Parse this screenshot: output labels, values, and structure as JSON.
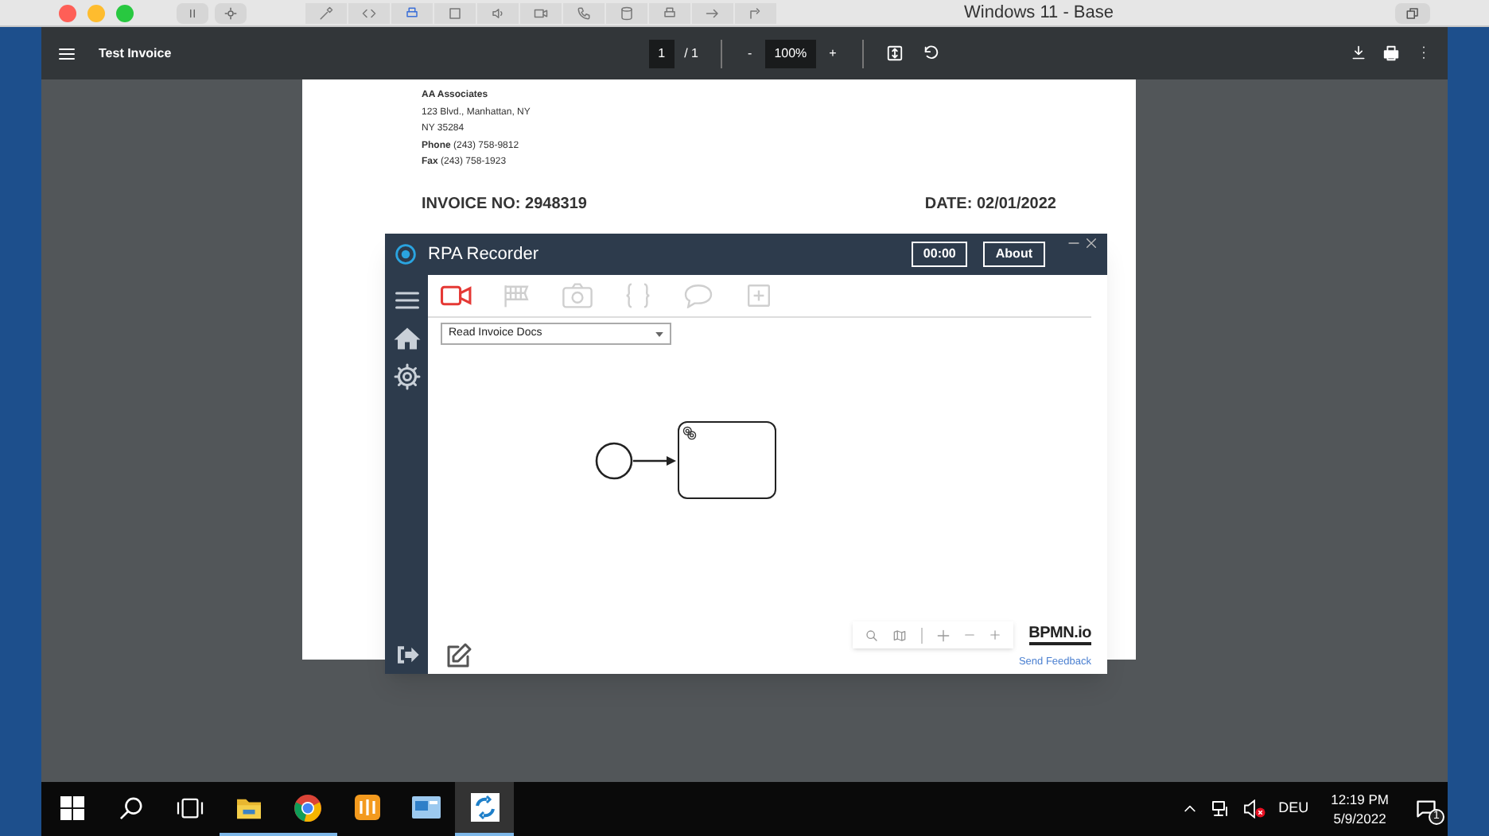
{
  "vm_window": {
    "title": "Windows 11 - Base"
  },
  "pdf_toolbar": {
    "title": "Test Invoice",
    "page": "1",
    "page_total": "/ 1",
    "zoom_out": "-",
    "zoom": "100%",
    "zoom_in": "+"
  },
  "document": {
    "sender_lines": [
      "**AA Associates**",
      "123 Blvd., Manhattan, NY",
      "NY 35284",
      "**Phone** (243) 758-9812",
      "**Fax** (243) 758-1923"
    ],
    "invoice_no": "INVOICE NO: 2948319",
    "date": "DATE: 02/01/2022"
  },
  "recorder": {
    "title": "RPA Recorder",
    "timer": "00:00",
    "about": "About",
    "tools": [
      {
        "kind": "video",
        "selected": true
      },
      {
        "kind": "flag",
        "selected": false
      },
      {
        "kind": "camera",
        "selected": false
      },
      {
        "kind": "braces",
        "selected": false
      },
      {
        "kind": "comment",
        "selected": false
      },
      {
        "kind": "plus",
        "selected": false
      }
    ],
    "process": "Read Invoice Docs",
    "brand": "BPMN.io",
    "feedback": "Send Feedback"
  },
  "taskbar": {
    "apps": [
      {
        "kind": "start",
        "selected": false,
        "running": false
      },
      {
        "kind": "search",
        "selected": false,
        "running": false
      },
      {
        "kind": "taskview",
        "selected": false,
        "running": false
      },
      {
        "kind": "folder",
        "selected": false,
        "running": true
      },
      {
        "kind": "browser",
        "selected": false,
        "running": true
      },
      {
        "kind": "grid",
        "selected": false,
        "running": false
      },
      {
        "kind": "monitor",
        "selected": false,
        "running": false
      },
      {
        "kind": "recorder",
        "selected": true,
        "running": true
      }
    ],
    "language": "DEU",
    "time": "12:19 PM",
    "date": "5/9/2022",
    "notifications": "1"
  }
}
